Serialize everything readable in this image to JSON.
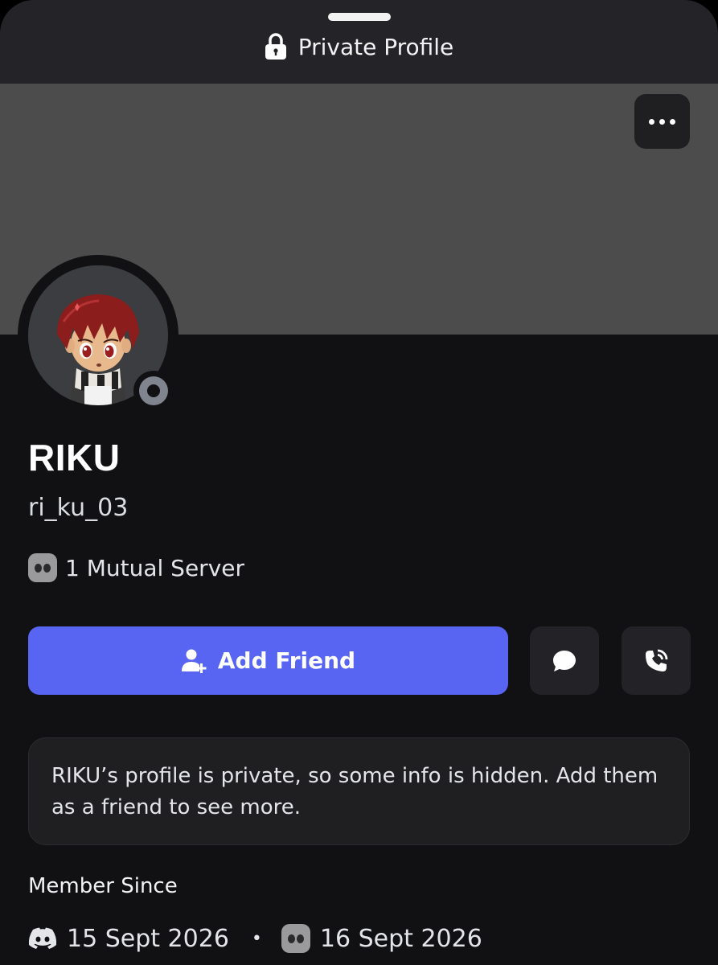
{
  "header": {
    "title": "Private Profile",
    "lock_icon": "lock-icon"
  },
  "banner": {
    "color": "#4c4c4d",
    "more_icon": "more-horizontal-icon"
  },
  "profile": {
    "display_name": "RIKU",
    "username": "ri_ku_03",
    "status": "offline",
    "mutual_servers": "1 Mutual Server"
  },
  "actions": {
    "add_friend_label": "Add Friend",
    "message_icon": "message-bubble-icon",
    "call_icon": "phone-call-icon",
    "accent": "#5865f2"
  },
  "notice": {
    "text": "RIKU’s profile is private, so some info is hidden. Add them as a friend to see more."
  },
  "member_since": {
    "title": "Member Since",
    "discord_date": "15 Sept 2026",
    "server_date": "16 Sept 2026"
  }
}
